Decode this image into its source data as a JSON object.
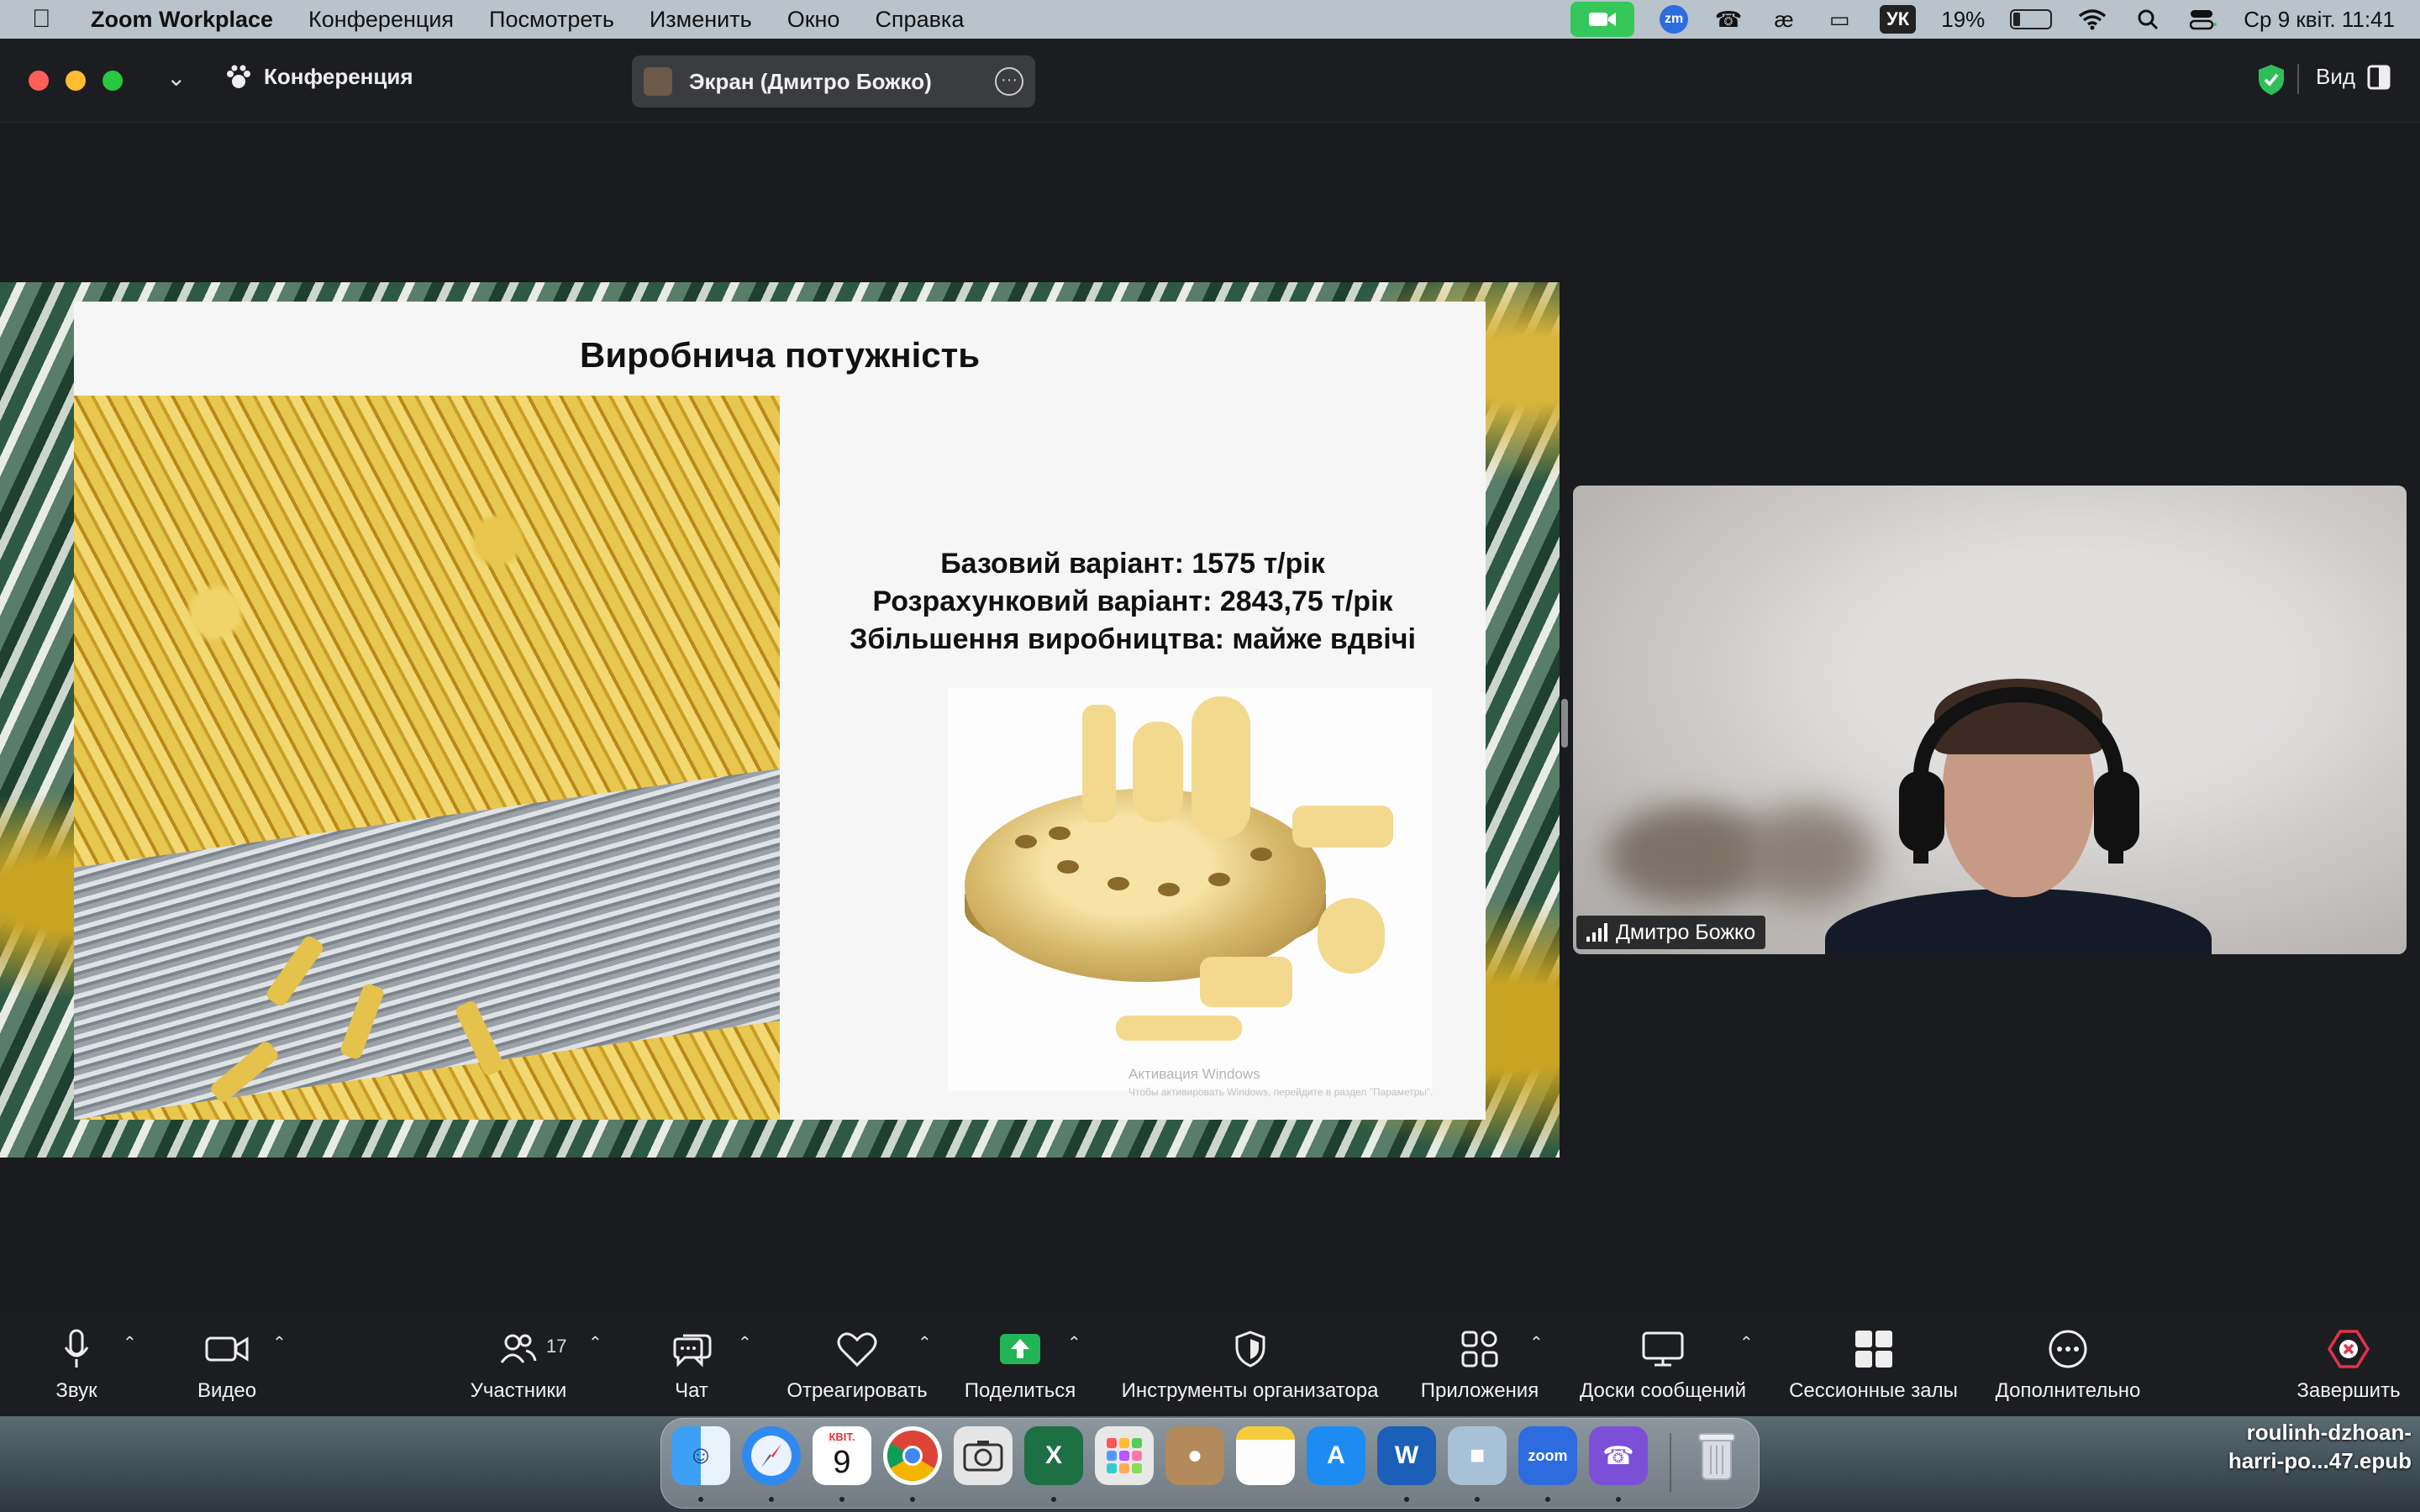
{
  "menubar": {
    "app_name": "Zoom Workplace",
    "menus": [
      "Конференция",
      "Посмотреть",
      "Изменить",
      "Окно",
      "Справка"
    ],
    "language": "УК",
    "battery": "19%",
    "battery_level": 0.19,
    "clock": "Ср 9 квіт.  11:41"
  },
  "window": {
    "meeting_label": "Конференция",
    "share_label": "Экран (Дмитро Божко)",
    "view_label": "Вид"
  },
  "slide": {
    "title": "Виробнича потужність",
    "lines": [
      "Базовий варіант: 1575 т/рік",
      "Розрахунковий варіант: 2843,75 т/рік",
      "Збільшення виробництва: майже вдвічі"
    ],
    "watermark_title": "Активация Windows",
    "watermark_sub": "Чтобы активировать Windows, перейдите в раздел \"Параметры\"."
  },
  "participant": {
    "name": "Дмитро Божко"
  },
  "toolbar": {
    "audio": "Звук",
    "video": "Видео",
    "participants": "Участники",
    "participants_count": "17",
    "chat": "Чат",
    "react": "Отреагировать",
    "share": "Поделиться",
    "host_tools": "Инструменты организатора",
    "apps": "Приложения",
    "whiteboards": "Доски сообщений",
    "breakout": "Сессионные залы",
    "more": "Дополнительно",
    "end": "Завершить"
  },
  "dock": {
    "calendar_month": "КВІТ.",
    "calendar_day": "9",
    "zoom_label": "zoom",
    "word_label": "W"
  },
  "desktop": {
    "file_line1": "roulinh-dzhoan-",
    "file_line2": "harri-po...47.epub"
  },
  "colors": {
    "share_green": "#22b455",
    "end_red": "#e0334a",
    "zoom_blue": "#2d6cdf"
  }
}
